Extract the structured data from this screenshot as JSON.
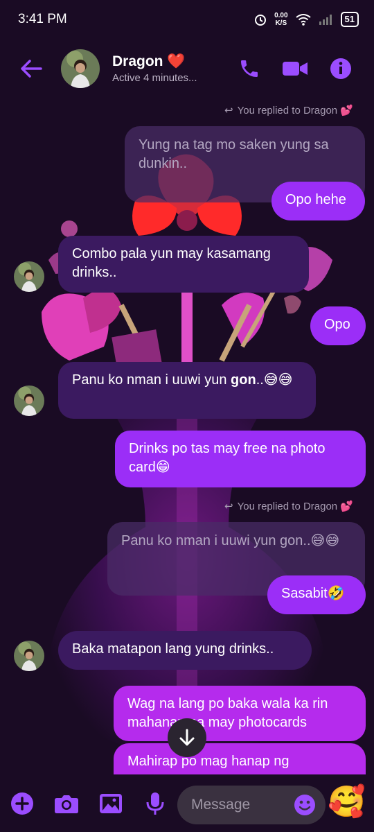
{
  "status": {
    "time": "3:41 PM",
    "net_speed_top": "0.00",
    "net_speed_bottom": "K/S",
    "battery": "51"
  },
  "header": {
    "name": "Dragon",
    "name_emoji": "❤️",
    "subtitle": "Active 4 minutes..."
  },
  "messages": {
    "replied_1": "You replied to Dragon 💕",
    "quote_1": "Yung na tag mo saken yung sa dunkin..",
    "out_1": "Opo hehe",
    "in_1": "Combo pala yun may kasamang drinks..",
    "out_2": "Opo",
    "in_2_pre": "Panu ko nman i uuwi yun ",
    "in_2_bold": "gon",
    "in_2_post": "..😅😅",
    "out_3": "Drinks po tas may free na photo card😁",
    "replied_2": "You replied to Dragon 💕",
    "quote_2": "Panu ko nman i uuwi yun gon..😅😅",
    "out_4": "Sasabit🤣",
    "in_3": "Baka matapon lang yung drinks..",
    "out_5": "Wag na lang po baka wala ka rin mahanap na may photocards",
    "out_6": "Mahirap po mag hanap ng"
  },
  "composer": {
    "placeholder": "Message",
    "emoji": "🥰"
  },
  "colors": {
    "accent": "#9b2ef7",
    "background": "#1a0b24",
    "incoming": "#3b1a60"
  }
}
